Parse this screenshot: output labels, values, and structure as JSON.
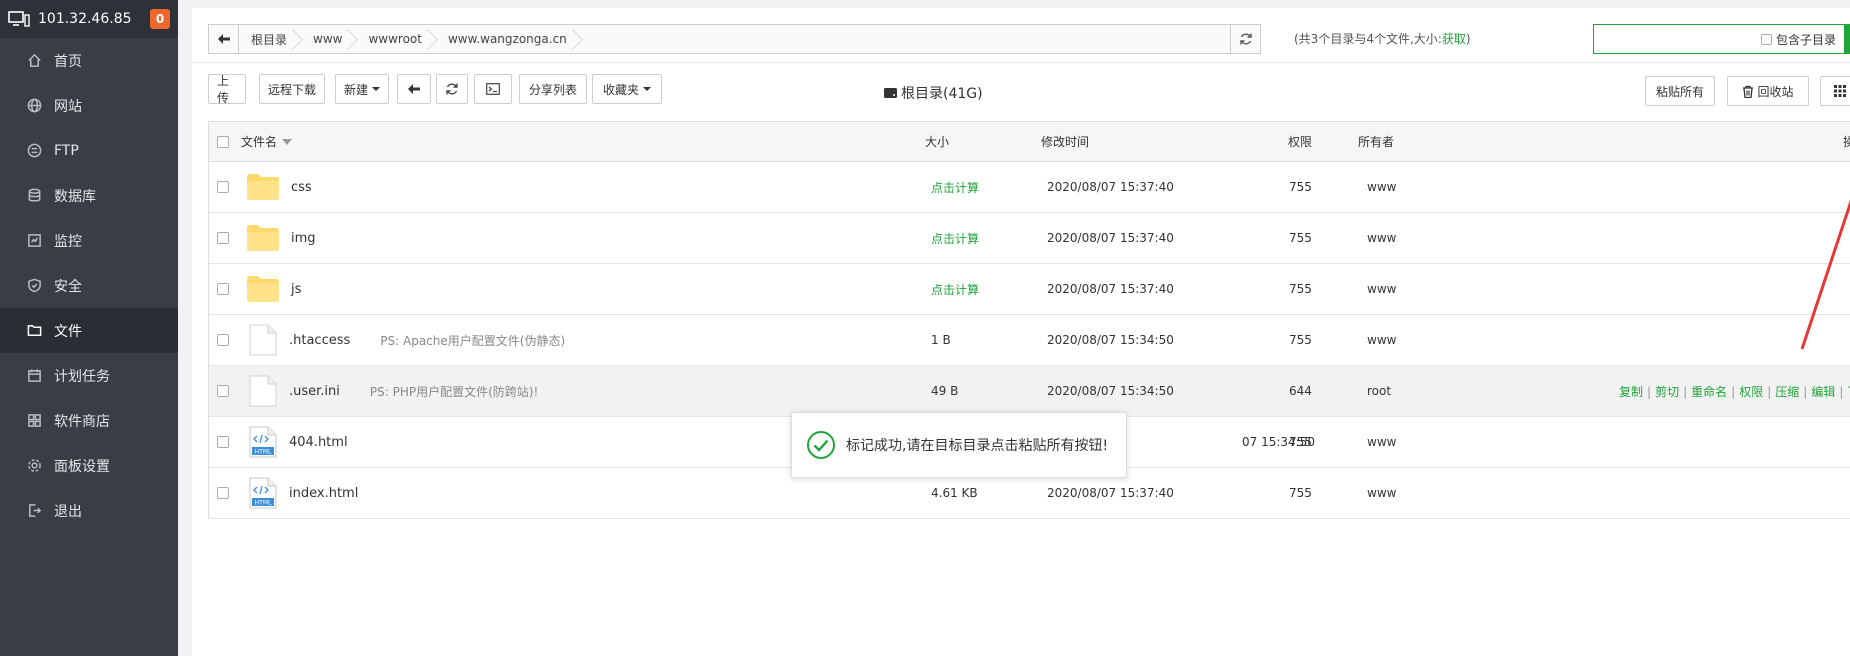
{
  "sidebar": {
    "ip": "101.32.46.85",
    "badge": "0",
    "items": [
      {
        "label": "首页",
        "icon": "home-icon"
      },
      {
        "label": "网站",
        "icon": "globe-icon"
      },
      {
        "label": "FTP",
        "icon": "ftp-icon"
      },
      {
        "label": "数据库",
        "icon": "database-icon"
      },
      {
        "label": "监控",
        "icon": "monitor-icon"
      },
      {
        "label": "安全",
        "icon": "shield-icon"
      },
      {
        "label": "文件",
        "icon": "folder-icon",
        "active": true
      },
      {
        "label": "计划任务",
        "icon": "calendar-icon"
      },
      {
        "label": "软件商店",
        "icon": "apps-icon"
      },
      {
        "label": "面板设置",
        "icon": "gear-icon"
      },
      {
        "label": "退出",
        "icon": "logout-icon"
      }
    ]
  },
  "path": {
    "crumbs": [
      "根目录",
      "www",
      "wwwroot",
      "www.wangzonga.cn"
    ],
    "info_prefix": "(共3个目录与4个文件,大小:",
    "info_link": "获取",
    "info_suffix": ")"
  },
  "search": {
    "include_subdir_label": "包含子目录"
  },
  "toolbar": {
    "upload": "上传",
    "remote_download": "远程下载",
    "new": "新建",
    "share_list": "分享列表",
    "favorites": "收藏夹",
    "disk": "根目录(41G)",
    "paste_all": "粘贴所有",
    "recycle_bin": "回收站"
  },
  "table": {
    "headers": {
      "name": "文件名",
      "size": "大小",
      "time": "修改时间",
      "perm": "权限",
      "owner": "所有者",
      "action": "操"
    },
    "rows": [
      {
        "type": "folder",
        "name": "css",
        "ps": "",
        "size": "点击计算",
        "time": "2020/08/07 15:37:40",
        "perm": "755",
        "owner": "www"
      },
      {
        "type": "folder",
        "name": "img",
        "ps": "",
        "size": "点击计算",
        "time": "2020/08/07 15:37:40",
        "perm": "755",
        "owner": "www"
      },
      {
        "type": "folder",
        "name": "js",
        "ps": "",
        "size": "点击计算",
        "time": "2020/08/07 15:37:40",
        "perm": "755",
        "owner": "www"
      },
      {
        "type": "file",
        "name": ".htaccess",
        "ps": "PS: Apache用户配置文件(伪静态)",
        "size": "1 B",
        "time": "2020/08/07 15:34:50",
        "perm": "755",
        "owner": "www"
      },
      {
        "type": "file",
        "name": ".user.ini",
        "ps": "PS: PHP用户配置文件(防跨站)!",
        "size": "49 B",
        "time": "2020/08/07 15:34:50",
        "perm": "644",
        "owner": "root"
      },
      {
        "type": "html",
        "name": "404.html",
        "ps": "",
        "size": "",
        "time": "07 15:34:50",
        "perm": "755",
        "owner": "www"
      },
      {
        "type": "html",
        "name": "index.html",
        "ps": "",
        "size": "4.61 KB",
        "time": "2020/08/07 15:37:40",
        "perm": "755",
        "owner": "www"
      }
    ],
    "row_actions": [
      "复制",
      "剪切",
      "重命名",
      "权限",
      "压缩",
      "编辑",
      "下载"
    ]
  },
  "toast": {
    "message": "标记成功,请在目标目录点击粘贴所有按钮!"
  },
  "colors": {
    "accent": "#20a53a",
    "sidebar_bg": "#3a3d44",
    "arrow": "#e53935"
  }
}
